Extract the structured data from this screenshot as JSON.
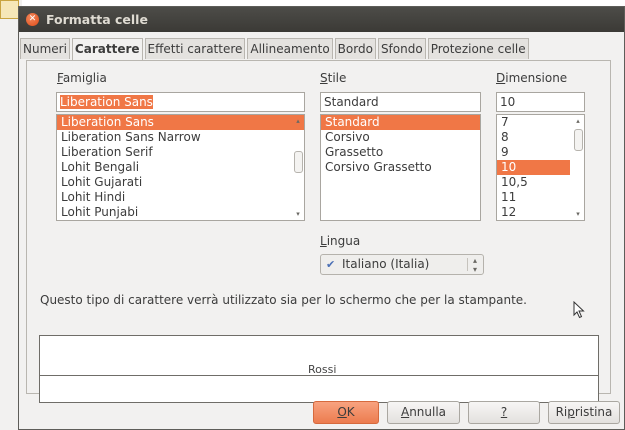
{
  "window": {
    "title": "Formatta celle"
  },
  "tabs": [
    {
      "label": "Numeri"
    },
    {
      "label": "Carattere"
    },
    {
      "label": "Effetti carattere"
    },
    {
      "label": "Allineamento"
    },
    {
      "label": "Bordo"
    },
    {
      "label": "Sfondo"
    },
    {
      "label": "Protezione celle"
    }
  ],
  "font": {
    "family_label_key": "F",
    "family_label_rest": "amiglia",
    "family_value": "Liberation Sans",
    "family_list": [
      "Liberation Sans",
      "Liberation Sans Narrow",
      "Liberation Serif",
      "Lohit Bengali",
      "Lohit Gujarati",
      "Lohit Hindi",
      "Lohit Punjabi"
    ],
    "style_label_key": "S",
    "style_label_rest": "tile",
    "style_value": "Standard",
    "style_list": [
      "Standard",
      "Corsivo",
      "Grassetto",
      "Corsivo Grassetto"
    ],
    "size_label_key": "D",
    "size_label_rest": "imensione",
    "size_value": "10",
    "size_list": [
      "7",
      "8",
      "9",
      "10",
      "10,5",
      "11",
      "12"
    ],
    "language_label_key": "L",
    "language_label_rest": "ingua",
    "language_value": "Italiano (Italia)",
    "language_icon": "spellcheck-icon"
  },
  "info_text": "Questo tipo di carattere verrà utilizzato sia per lo schermo che per la stampante.",
  "preview": {
    "sample": "Rossi"
  },
  "buttons": {
    "ok_key": "O",
    "ok_rest": "K",
    "cancel_key": "A",
    "cancel_rest": "nnulla",
    "help_key": "?",
    "help_rest": "",
    "reset_pre": "Ri",
    "reset_key": "p",
    "reset_rest": "ristina"
  },
  "colors": {
    "accent": "#f07746",
    "titlebar": "#3c3b37"
  }
}
